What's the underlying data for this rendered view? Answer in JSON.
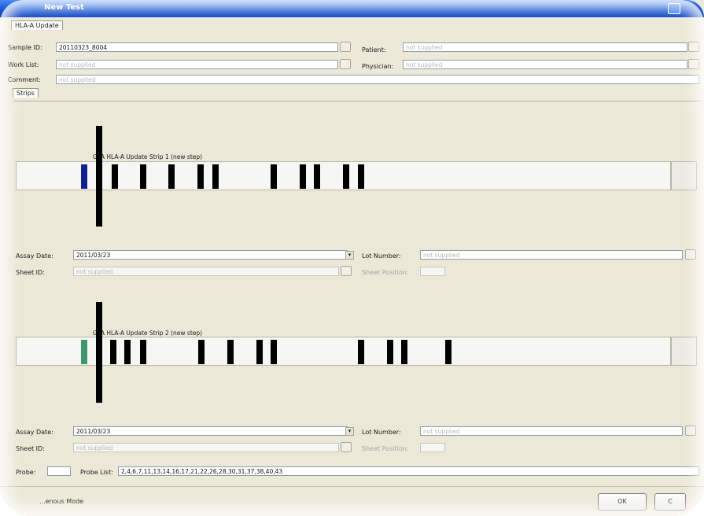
{
  "window": {
    "title": "New Test"
  },
  "tabs": {
    "main": "HLA-A Update",
    "strips": "Strips"
  },
  "form": {
    "sample_id_label": "Sample ID:",
    "sample_id_value": "20110323_8004",
    "worklist_label": "Work List:",
    "worklist_placeholder": "not supplied",
    "comment_label": "Comment:",
    "comment_placeholder": "not supplied",
    "patient_label": "Patient:",
    "patient_placeholder": "not supplied",
    "physician_label": "Physician:",
    "physician_placeholder": "not supplied"
  },
  "strips": [
    {
      "title": "GPA HLA-A Update Strip 1 (new step)",
      "color": "#11208f",
      "assay_date_label": "Assay Date:",
      "assay_date": "2011/03/23",
      "sheet_id_label": "Sheet ID:",
      "sheet_id_placeholder": "not supplied",
      "lot_number_label": "Lot Number:",
      "lot_number_placeholder": "not supplied",
      "sheet_position_label": "Sheet Position:"
    },
    {
      "title": "GPA HLA-A Update Strip 2 (new step)",
      "color": "#3e9a6e",
      "assay_date_label": "Assay Date:",
      "assay_date": "2011/03/23",
      "sheet_id_label": "Sheet ID:",
      "sheet_id_placeholder": "not supplied",
      "lot_number_label": "Lot Number:",
      "lot_number_placeholder": "not supplied",
      "sheet_position_label": "Sheet Position:"
    }
  ],
  "probe": {
    "probe_label": "Probe:",
    "probe_value": "",
    "probe_list_label": "Probe List:",
    "probe_list_value": "2,4,6,7,11,13,14,16,17,21,22,26,28,30,31,37,38,40,43"
  },
  "footer": {
    "mode_label": "...enous Mode",
    "ok_label": "OK",
    "cancel_label": "C"
  },
  "icons": {
    "ellipsis": "ellipsis-button-icon",
    "dropdown": "dropdown-arrow-icon"
  }
}
